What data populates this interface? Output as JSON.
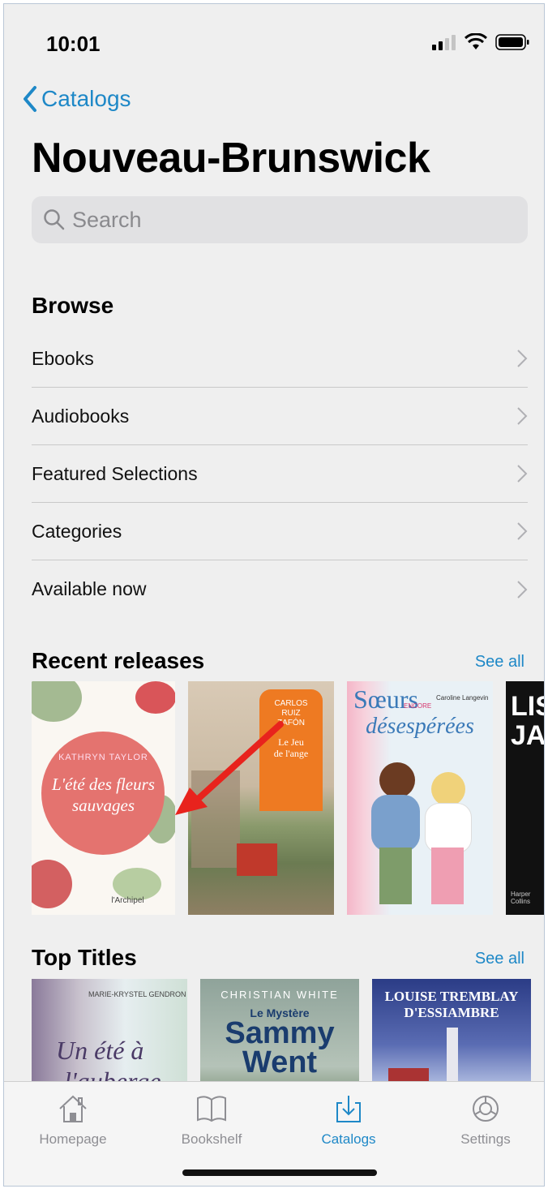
{
  "status": {
    "time": "10:01"
  },
  "nav": {
    "back_label": "Catalogs",
    "title": "Nouveau-Brunswick"
  },
  "search": {
    "placeholder": "Search"
  },
  "browse": {
    "header": "Browse",
    "items": [
      {
        "label": "Ebooks"
      },
      {
        "label": "Audiobooks"
      },
      {
        "label": "Featured Selections"
      },
      {
        "label": "Categories"
      },
      {
        "label": "Available now"
      }
    ]
  },
  "recent": {
    "header": "Recent releases",
    "see_all": "See all",
    "books": [
      {
        "author": "KATHRYN TAYLOR",
        "title_line1": "L'été des fleurs",
        "title_line2": "sauvages",
        "publisher": "l'Archipel"
      },
      {
        "author_line1": "CARLOS",
        "author_line2": "RUIZ",
        "author_line3": "ZAFÓN",
        "title_line1": "Le Jeu",
        "title_line2": "de l'ange"
      },
      {
        "title_line1": "Sœurs",
        "title_mid": "ENCORE",
        "title_line2": "désespérées",
        "author": "Caroline Langevin"
      },
      {
        "title_line1": "LIS",
        "title_line2": "JA",
        "publisher": "Harper Collins"
      }
    ]
  },
  "top": {
    "header": "Top Titles",
    "see_all": "See all",
    "books": [
      {
        "author": "MARIE-KRYSTEL GENDRON",
        "title_line1": "Un été à",
        "title_line2": "l'auberge"
      },
      {
        "author": "CHRISTIAN WHITE",
        "title_line1": "Le Mystère",
        "title_line2": "Sammy",
        "title_line3": "Went"
      },
      {
        "author_line1": "LOUISE TREMBLAY",
        "author_line2": "D'ESSIAMBRE"
      }
    ]
  },
  "tabs": [
    {
      "label": "Homepage",
      "icon": "home-icon"
    },
    {
      "label": "Bookshelf",
      "icon": "book-icon"
    },
    {
      "label": "Catalogs",
      "icon": "download-icon",
      "active": true
    },
    {
      "label": "Settings",
      "icon": "gear-icon"
    }
  ],
  "colors": {
    "accent": "#1e88c7",
    "annotation_arrow": "#e8231d"
  }
}
